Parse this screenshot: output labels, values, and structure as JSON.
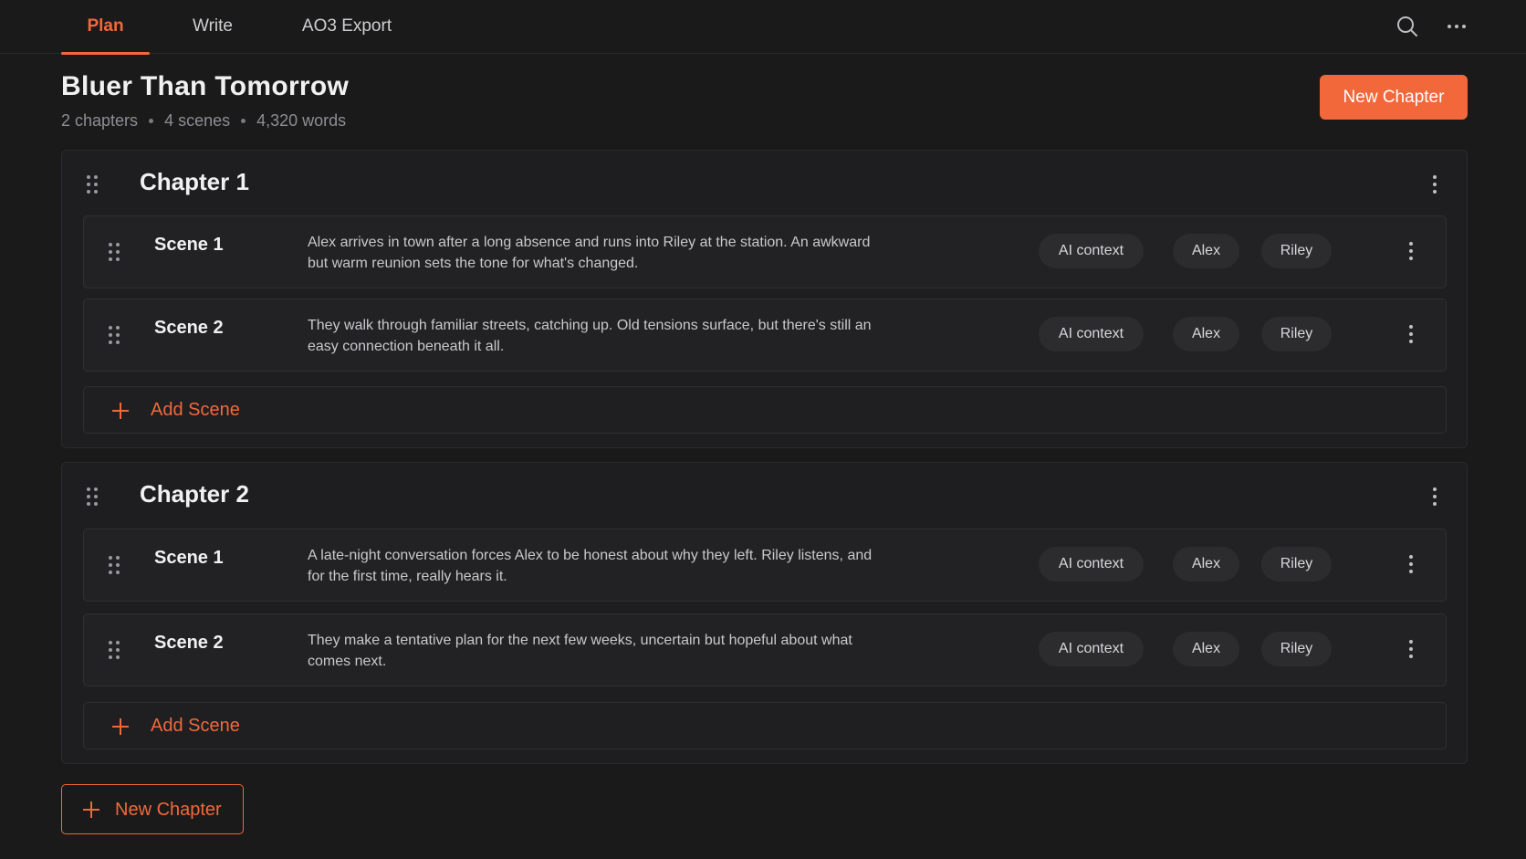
{
  "nav": {
    "tabs": [
      {
        "label": "Plan",
        "active": true
      },
      {
        "label": "Write",
        "active": false
      },
      {
        "label": "AO3 Export",
        "active": false
      }
    ],
    "icons": [
      "search-icon",
      "more-horizontal-icon"
    ]
  },
  "header": {
    "title": "Bluer Than Tomorrow",
    "meta": {
      "chapters": "2 chapters",
      "scenes": "4 scenes",
      "words": "4,320 words"
    },
    "new_chapter_label": "New Chapter"
  },
  "colors": {
    "accent": "#f2683a",
    "background": "#1a1a1b",
    "card": "#1e1e20"
  },
  "chapters": [
    {
      "title": "Chapter 1",
      "scenes": [
        {
          "title": "Scene 1",
          "summary": "Alex arrives in town after a long absence and runs into Riley at the station. An awkward but warm reunion sets the tone for what's changed.",
          "tags": [
            "AI context",
            "Alex",
            "Riley"
          ]
        },
        {
          "title": "Scene 2",
          "summary": "They walk through familiar streets, catching up. Old tensions surface, but there's still an easy connection beneath it all.",
          "tags": [
            "AI context",
            "Alex",
            "Riley"
          ]
        }
      ],
      "add_scene_label": "Add Scene"
    },
    {
      "title": "Chapter 2",
      "scenes": [
        {
          "title": "Scene 1",
          "summary": "A late-night conversation forces Alex to be honest about why they left. Riley listens, and for the first time, really hears it.",
          "tags": [
            "AI context",
            "Alex",
            "Riley"
          ]
        },
        {
          "title": "Scene 2",
          "summary": "They make a tentative plan for the next few weeks, uncertain but hopeful about what comes next.",
          "tags": [
            "AI context",
            "Alex",
            "Riley"
          ]
        }
      ],
      "add_scene_label": "Add Scene"
    }
  ],
  "footer": {
    "new_chapter_label": "New Chapter"
  }
}
